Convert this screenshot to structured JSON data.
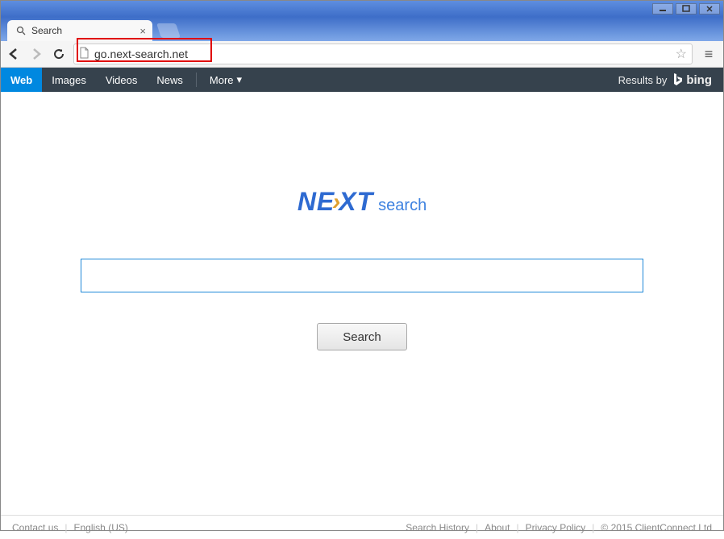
{
  "window": {
    "tab_title": "Search"
  },
  "address_bar": {
    "url": "go.next-search.net"
  },
  "category_nav": {
    "items": [
      {
        "label": "Web",
        "active": true
      },
      {
        "label": "Images",
        "active": false
      },
      {
        "label": "Videos",
        "active": false
      },
      {
        "label": "News",
        "active": false
      }
    ],
    "more_label": "More",
    "results_by_label": "Results by",
    "provider": "bing"
  },
  "brand": {
    "part1": "N",
    "part2": "E",
    "part3": "XT",
    "suffix": "search"
  },
  "search": {
    "input_value": "",
    "button_label": "Search"
  },
  "footer": {
    "left": [
      {
        "label": "Contact us"
      },
      {
        "label": "English (US)"
      }
    ],
    "right": [
      {
        "label": "Search History"
      },
      {
        "label": "About"
      },
      {
        "label": "Privacy Policy"
      },
      {
        "label": "© 2015 ClientConnect Ltd"
      }
    ]
  }
}
